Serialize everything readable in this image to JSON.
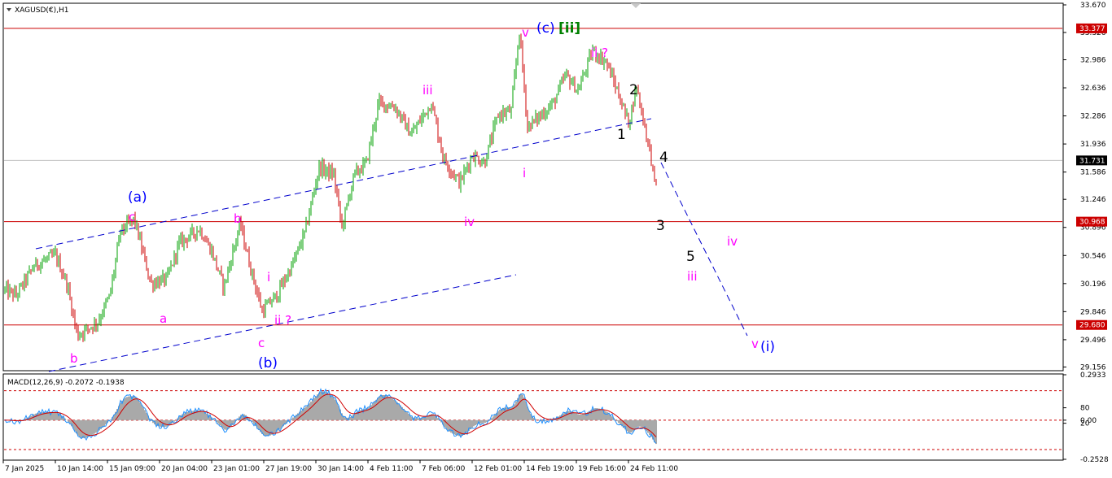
{
  "chart_data": {
    "type": "candlestick",
    "symbol_label": "XAGUSD(€),H1",
    "price_axis": {
      "range": [
        29.12,
        33.68
      ],
      "ticks": [
        "33.670",
        "33.326",
        "32.986",
        "32.636",
        "32.286",
        "31.936",
        "31.586",
        "31.246",
        "30.896",
        "30.546",
        "30.196",
        "29.846",
        "29.496",
        "29.156"
      ],
      "tick_values": [
        33.67,
        33.326,
        32.986,
        32.636,
        32.286,
        31.936,
        31.586,
        31.246,
        30.896,
        30.546,
        30.196,
        29.846,
        29.496,
        29.156
      ]
    },
    "time_axis": {
      "ticks": [
        "7 Jan 2025",
        "10 Jan 14:00",
        "15 Jan 09:00",
        "20 Jan 04:00",
        "23 Jan 01:00",
        "27 Jan 19:00",
        "30 Jan 14:00",
        "4 Feb 11:00",
        "7 Feb 06:00",
        "12 Feb 01:00",
        "14 Feb 19:00",
        "19 Feb 16:00",
        "24 Feb 11:00"
      ]
    },
    "current_price": {
      "label": "31.731",
      "value": 31.731
    },
    "horizontal_levels": [
      {
        "label": "33.377",
        "value": 33.377,
        "color": "#cc0000"
      },
      {
        "label": "30.968",
        "value": 30.968,
        "color": "#cc0000"
      },
      {
        "label": "29.680",
        "value": 29.68,
        "color": "#cc0000"
      }
    ],
    "wave_labels": [
      {
        "text": "(a)",
        "color": "#0000ff"
      },
      {
        "text": "c",
        "color": "#ff00ff"
      },
      {
        "text": "b",
        "color": "#ff00ff"
      },
      {
        "text": "a",
        "color": "#ff00ff"
      },
      {
        "text": "b",
        "color": "#ff00ff"
      },
      {
        "text": "i",
        "color": "#ff00ff"
      },
      {
        "text": "ii ?",
        "color": "#ff00ff"
      },
      {
        "text": "c",
        "color": "#ff00ff"
      },
      {
        "text": "(b)",
        "color": "#0000ff"
      },
      {
        "text": "iii",
        "color": "#ff00ff"
      },
      {
        "text": "iv",
        "color": "#ff00ff"
      },
      {
        "text": "v",
        "color": "#ff00ff"
      },
      {
        "text": "(c)",
        "color": "#0000ff"
      },
      {
        "text": "[ii]",
        "color": "#008000"
      },
      {
        "text": "i",
        "color": "#ff00ff"
      },
      {
        "text": "ii ?",
        "color": "#ff00ff"
      },
      {
        "text": "2",
        "color": "#000000"
      },
      {
        "text": "1",
        "color": "#000000"
      },
      {
        "text": "4",
        "color": "#000000"
      },
      {
        "text": "3",
        "color": "#000000"
      },
      {
        "text": "iv",
        "color": "#ff00ff"
      },
      {
        "text": "5",
        "color": "#000000"
      },
      {
        "text": "iii",
        "color": "#ff00ff"
      },
      {
        "text": "v",
        "color": "#ff00ff"
      },
      {
        "text": "(i)",
        "color": "#0000ff"
      }
    ],
    "macd": {
      "label": "MACD(12,26,9) -0.2072 -0.1938",
      "ticks": [
        "0.2933",
        "80",
        "0.00",
        "20",
        "-0.2528"
      ],
      "tick_values": [
        0.2933,
        0.08,
        0.0,
        -0.02,
        -0.2528
      ],
      "levels": [
        0.19,
        0.0,
        -0.19
      ],
      "current_macd": -0.2072,
      "current_signal": -0.1938
    },
    "colors": {
      "bull": "#00a000",
      "bear": "#cc0000",
      "trend_lines": "#0000cc",
      "levels": "#cc0000",
      "current_price_line": "#c0c0c0",
      "macd_histogram": "#a9a9a9",
      "macd_signal": "#d00000",
      "macd_line": "#1e90ff"
    }
  }
}
